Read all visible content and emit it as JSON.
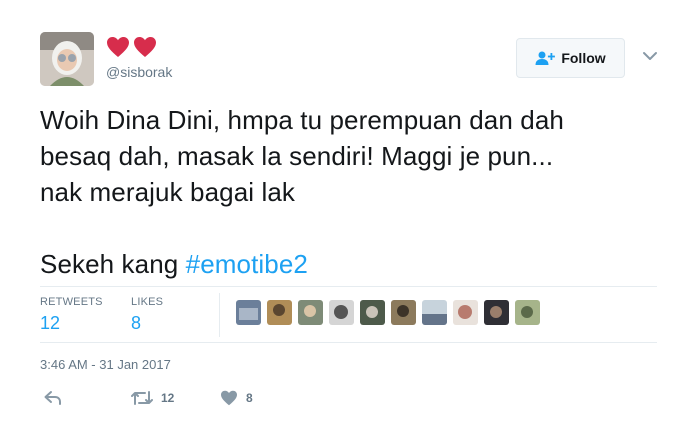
{
  "user": {
    "display_name_icons": [
      "heart-icon",
      "heart-icon"
    ],
    "handle": "@sisborak",
    "heart_color": "#e0245e"
  },
  "follow_button": {
    "label": "Follow",
    "icon": "add-user-icon"
  },
  "tweet": {
    "lines": [
      "Woih Dina Dini, hmpa tu perempuan dan dah",
      "besaq dah, masak la sendiri! Maggi je pun...",
      "nak merajuk bagai lak"
    ],
    "line4_prefix": "Sekeh kang ",
    "hashtag": "#emotibe2"
  },
  "stats": {
    "retweets_label": "RETWEETS",
    "retweets_value": "12",
    "likes_label": "LIKES",
    "likes_value": "8"
  },
  "timestamp": "3:46 AM - 31 Jan 2017",
  "actions": {
    "reply_icon": "reply-icon",
    "retweet_icon": "retweet-icon",
    "retweet_count": "12",
    "like_icon": "heart-icon",
    "like_count": "8"
  },
  "colors": {
    "link": "#1da1f2",
    "muted": "#657786",
    "text": "#14171a",
    "divider": "#e6ecf0"
  }
}
